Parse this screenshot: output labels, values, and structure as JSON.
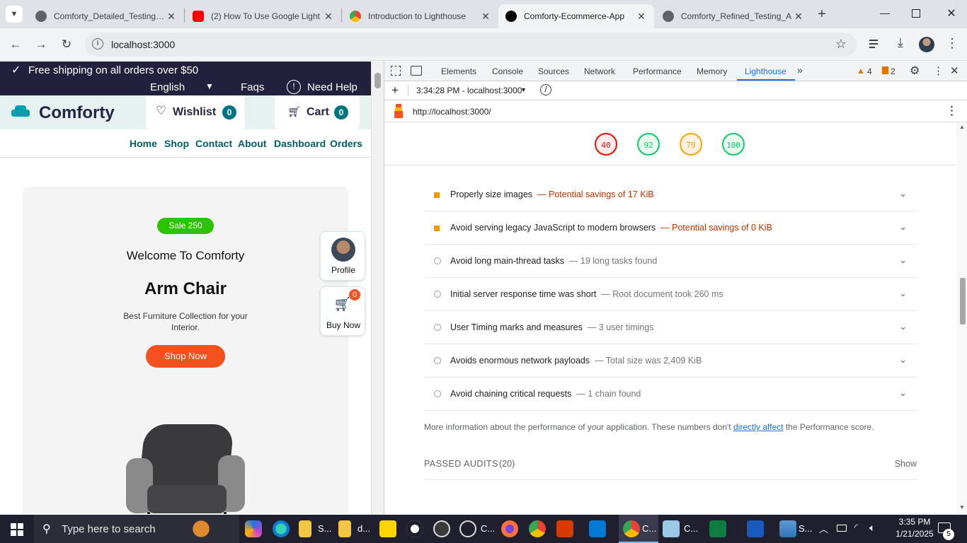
{
  "browser": {
    "tabs": [
      {
        "label": "Comforty_Detailed_Testing_A",
        "favicon_color": "#5f6368",
        "active": false
      },
      {
        "label": "(2) How To Use Google Light",
        "favicon_color": "#ff0000",
        "active": false
      },
      {
        "label": "Introduction to Lighthouse",
        "favicon_color": "#4285f4",
        "active": false
      },
      {
        "label": "Comforty-Ecommerce-App",
        "favicon_color": "#000000",
        "active": true
      },
      {
        "label": "Comforty_Refined_Testing_A",
        "favicon_color": "#5f6368",
        "active": false
      }
    ],
    "new_tab_icon": "plus-icon",
    "url": "localhost:3000"
  },
  "site": {
    "announcement": "Free shipping on all orders over $50",
    "language": "English",
    "faqs": "Faqs",
    "need_help": "Need Help",
    "logo": "Comforty",
    "wishlist_label": "Wishlist",
    "wishlist_count": "0",
    "cart_label": "Cart",
    "cart_count": "0",
    "nav": [
      "Home",
      "Shop",
      "Contact",
      "About",
      "Dashboard",
      "Orders"
    ],
    "hero": {
      "badge": "Sale 250",
      "welcome": "Welcome To Comforty",
      "title": "Arm Chair",
      "subtitle_line1": "Best Furniture Collection for your",
      "subtitle_line2": "Interior.",
      "cta": "Shop Now"
    },
    "profile_label": "Profile",
    "buy_now_label": "Buy Now",
    "buy_now_badge": "0",
    "brand_color": "#015f63",
    "accent_color": "#f4511e"
  },
  "devtools": {
    "tabs": [
      "Elements",
      "Console",
      "Sources",
      "Network",
      "Performance",
      "Memory",
      "Lighthouse"
    ],
    "active_tab": "Lighthouse",
    "warnings_count": "4",
    "issues_count": "2",
    "report_time": "3:34:28 PM - localhost:3000",
    "report_url": "http://localhost:3000/",
    "scores": [
      {
        "value": "40",
        "color": "#eb0f00",
        "bg": "#ffebeb"
      },
      {
        "value": "92",
        "color": "#0cce6b",
        "bg": "#e8f9ee"
      },
      {
        "value": "79",
        "color": "#ffa400",
        "bg": "#fff3e0"
      },
      {
        "value": "100",
        "color": "#0cce6b",
        "bg": "#e8f9ee"
      }
    ],
    "audits": [
      {
        "title": "Properly size images",
        "detail": "— Potential savings of 17 KiB",
        "kind": "warn"
      },
      {
        "title": "Avoid serving legacy JavaScript to modern browsers",
        "detail": "— Potential savings of 0 KiB",
        "kind": "warn"
      },
      {
        "title": "Avoid long main-thread tasks",
        "detail": "— 19 long tasks found",
        "kind": "info"
      },
      {
        "title": "Initial server response time was short",
        "detail": "— Root document took 260 ms",
        "kind": "info"
      },
      {
        "title": "User Timing marks and measures",
        "detail": "— 3 user timings",
        "kind": "info"
      },
      {
        "title": "Avoids enormous network payloads",
        "detail": "— Total size was 2,409 KiB",
        "kind": "info"
      },
      {
        "title": "Avoid chaining critical requests",
        "detail": "— 1 chain found",
        "kind": "info"
      }
    ],
    "more_info_before": "More information about the performance of your application. These numbers don't",
    "more_info_link": "directly affect",
    "more_info_after": "the Performance score.",
    "passed_audits": "PASSED AUDITS",
    "passed_count": "(20)",
    "show_label": "Show"
  },
  "taskbar": {
    "search_placeholder": "Type here to search",
    "time": "3:35 PM",
    "date": "1/21/2025",
    "notification_count": "5",
    "item_labels": [
      "S...",
      "d...",
      "C...",
      "C...",
      "C...",
      "S..."
    ]
  }
}
